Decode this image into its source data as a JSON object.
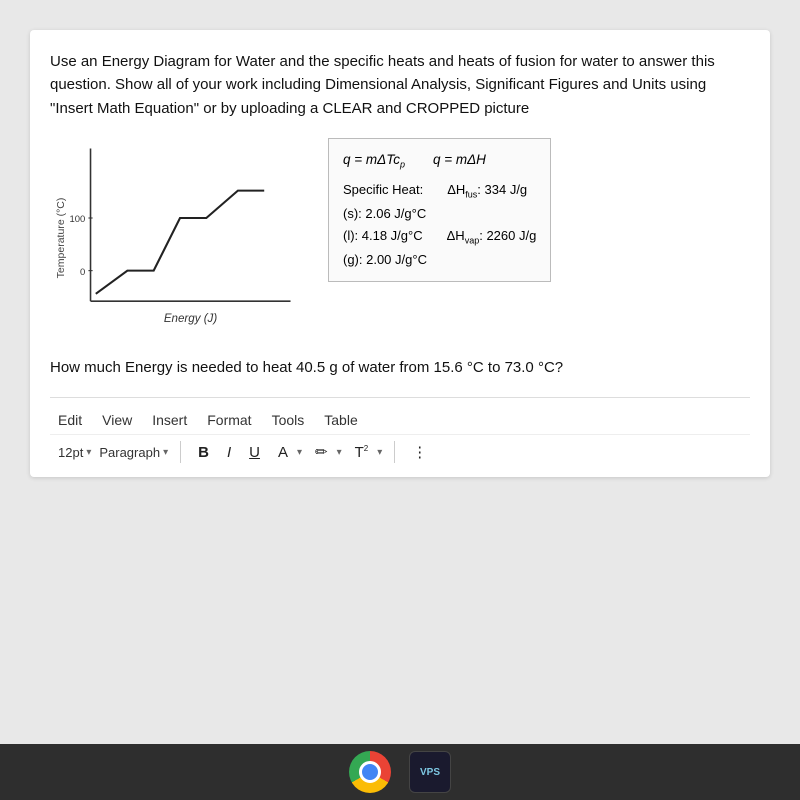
{
  "question1": {
    "text": "Use an Energy Diagram for Water and the specific heats and heats of fusion for water to answer this question. Show all of your work including Dimensional Analysis, Significant Figures and Units using \"Insert Math Equation\" or by uploading a CLEAR and CROPPED picture"
  },
  "formula_box": {
    "formula1": "q = mΔTc",
    "formula1_sub": "p",
    "formula2": "q = mΔH",
    "specific_heat_label": "Specific Heat:",
    "sh_s": "(s): 2.06 J/g°C",
    "sh_l": "(l): 4.18 J/g°C",
    "sh_g": "(g): 2.00 J/g°C",
    "delta_h_fus_label": "ΔH",
    "delta_h_fus_sub": "fus",
    "delta_h_fus_value": ": 334 J/g",
    "delta_h_vap_label": "ΔH",
    "delta_h_vap_sub": "vap",
    "delta_h_vap_value": ": 2260 J/g"
  },
  "graph": {
    "x_label": "Energy (J)",
    "y_label": "Temperature (°C)",
    "y_100": "100",
    "y_0": "0"
  },
  "question2": {
    "text": "How much Energy is needed to heat 40.5 g of water from 15.6 °C to 73.0 °C?"
  },
  "menu_bar": {
    "items": [
      "Edit",
      "View",
      "Insert",
      "Format",
      "Tools",
      "Table"
    ]
  },
  "formatting_bar": {
    "font_size": "12pt",
    "paragraph": "Paragraph",
    "bold_label": "B",
    "italic_label": "I",
    "underline_label": "U",
    "font_color_label": "A",
    "highlight_label": "🖊",
    "superscript_label": "T²",
    "more_label": "⋮"
  },
  "taskbar": {
    "chrome_label": "Chrome",
    "vps_label": "VPS"
  }
}
